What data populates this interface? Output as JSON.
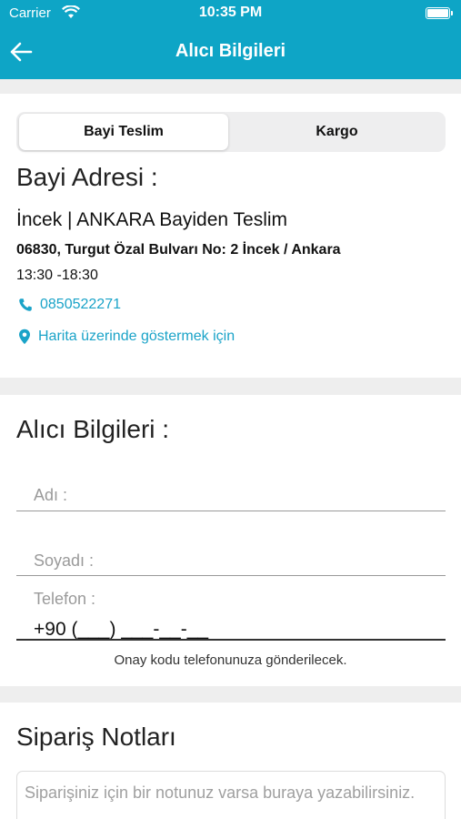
{
  "status_bar": {
    "carrier": "Carrier",
    "time": "10:35 PM"
  },
  "header": {
    "title": "Alıcı Bilgileri"
  },
  "delivery_tabs": [
    {
      "label": "Bayi Teslim",
      "selected": true
    },
    {
      "label": "Kargo",
      "selected": false
    }
  ],
  "dealer": {
    "heading": "Bayi Adresi :",
    "name": "İncek | ANKARA  Bayiden Teslim",
    "address": "06830, Turgut Özal Bulvarı No: 2 İncek / Ankara",
    "hours": "13:30 -18:30",
    "phone": "0850522271",
    "map_link": "Harita üzerinde göstermek için"
  },
  "recipient": {
    "heading": "Alıcı Bilgileri :",
    "first_name_placeholder": "Adı :",
    "last_name_placeholder": "Soyadı :",
    "phone_label": "Telefon :",
    "phone_value": "+90 (___) ___-__-__",
    "phone_hint": "Onay kodu telefonunuza gönderilecek."
  },
  "notes": {
    "heading": "Sipariş Notları",
    "placeholder": "Siparişiniz için bir notunuz varsa buraya yazabilirsiniz."
  },
  "colors": {
    "accent": "#0ea5c6",
    "link": "#1aa3c8"
  }
}
